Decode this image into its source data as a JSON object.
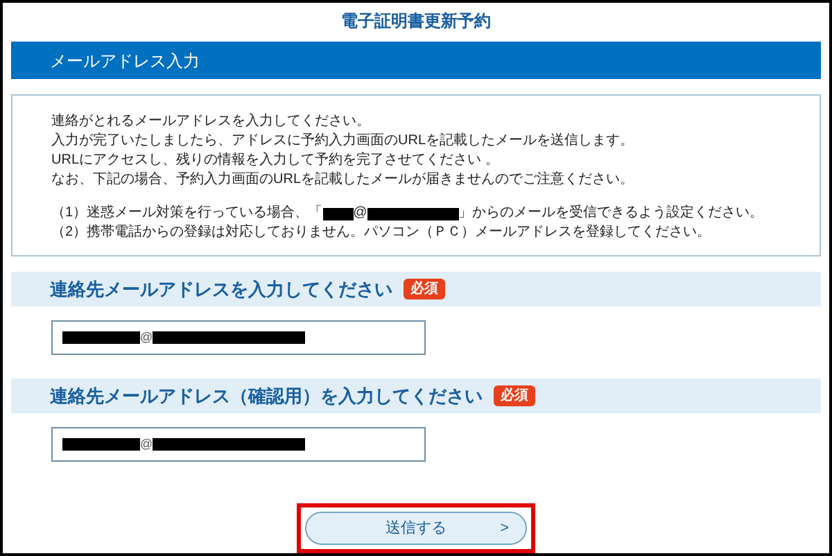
{
  "page_title": "電子証明書更新予約",
  "section_title": "メールアドレス入力",
  "instructions": [
    "連絡がとれるメールアドレスを入力してください。",
    "入力が完了いたしましたら、アドレスに予約入力画面のURLを記載したメールを送信します。",
    "URLにアクセスし、残りの情報を入力して予約を完了させてください 。",
    "なお、下記の場合、予約入力画面のURLを記載したメールが届きませんのでご注意ください。"
  ],
  "notes": [
    {
      "kind": "sender",
      "before": "（1）迷惑メール対策を行っている場合、「",
      "at": "@",
      "after": "」からのメールを受信できるよう設定ください。"
    },
    {
      "kind": "plain",
      "text": "（2）携帯電話からの登録は対応しておりません。パソコン（ＰＣ）メールアドレスを登録してください。"
    }
  ],
  "fields": [
    {
      "label": "連絡先メールアドレスを入力してください",
      "badge": "必須",
      "value": "@"
    },
    {
      "label": "連絡先メールアドレス（確認用）を入力してください",
      "badge": "必須",
      "value": "@"
    }
  ],
  "submit": {
    "label": "送信する",
    "arrow": ">",
    "highlighted": true
  }
}
